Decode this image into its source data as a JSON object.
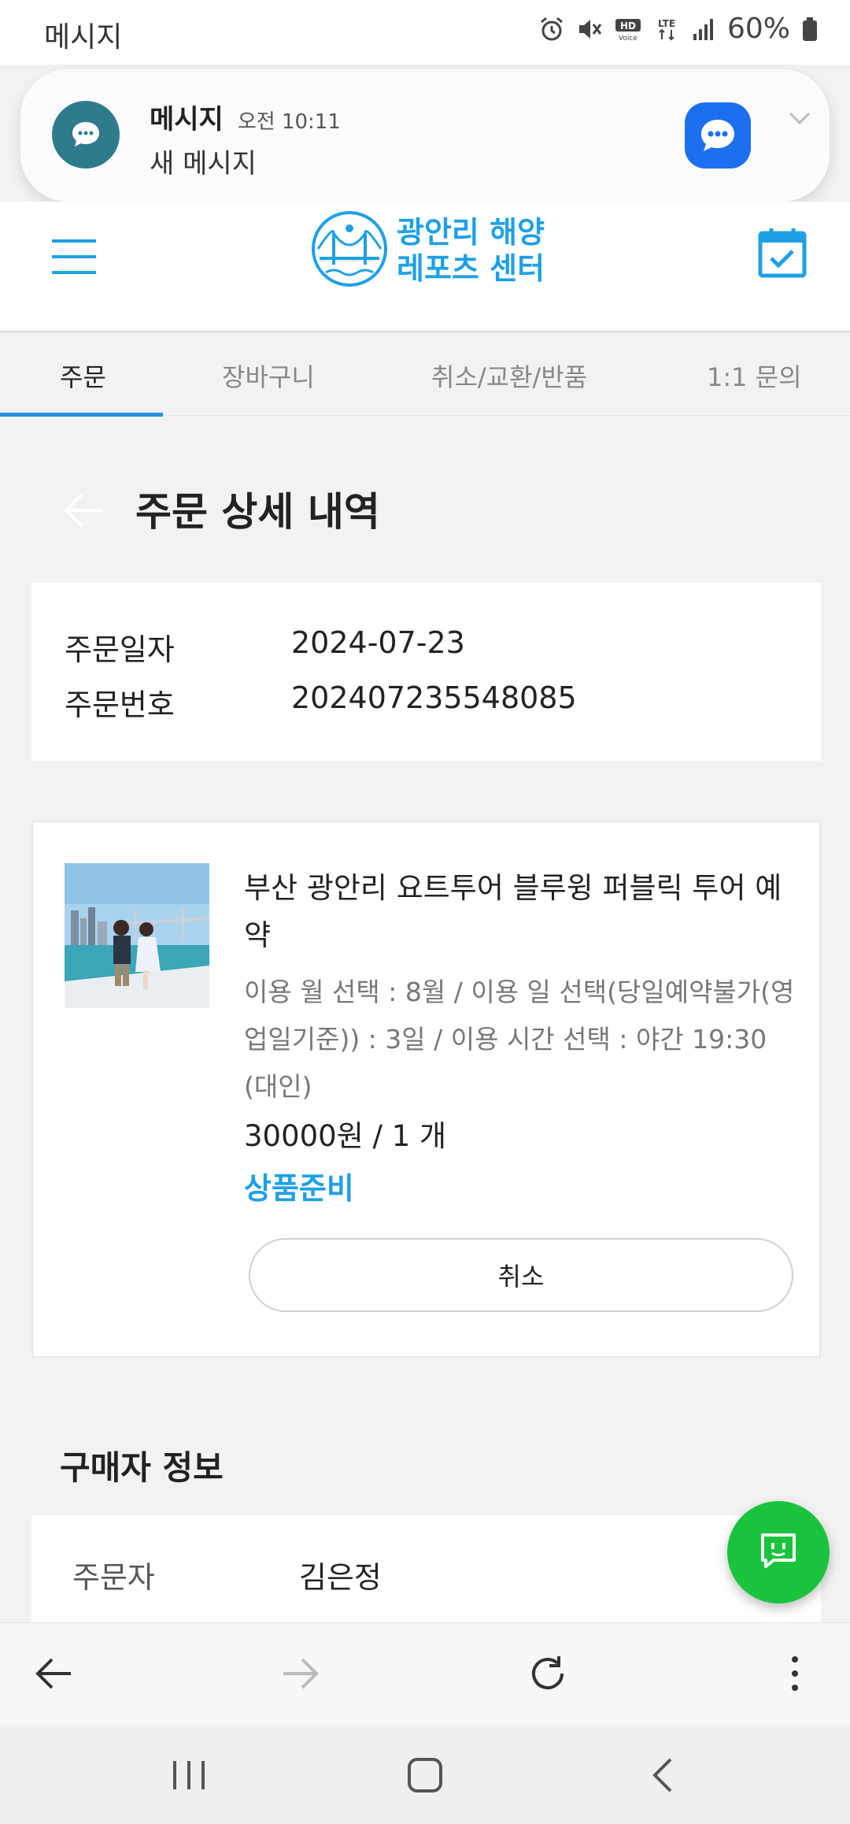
{
  "status_bar": {
    "app_name": "메시지",
    "battery": "60%"
  },
  "notification": {
    "title": "메시지",
    "time": "오전 10:11",
    "body": "새 메시지"
  },
  "header": {
    "logo_line1": "광안리 해양",
    "logo_line2": "레포츠 센터"
  },
  "tabs": [
    {
      "label": "주문"
    },
    {
      "label": "장바구니"
    },
    {
      "label": "취소/교환/반품"
    },
    {
      "label": "1:1 문의"
    }
  ],
  "page": {
    "title": "주문 상세 내역"
  },
  "order_info": {
    "date_label": "주문일자",
    "date_value": "2024-07-23",
    "number_label": "주문번호",
    "number_value": "202407235548085"
  },
  "product": {
    "name": "부산 광안리 요트투어 블루윙 퍼블릭 투어 예약",
    "options": "이용 월 선택 : 8월 / 이용 일 선택(당일예약불가(영업일기준)) : 3일 / 이용 시간 선택 : 야간 19:30 (대인)",
    "price": "30000원 / 1 개",
    "status": "상품준비",
    "cancel_label": "취소"
  },
  "buyer": {
    "section_title": "구매자 정보",
    "orderer_label": "주문자",
    "orderer_value": "김은정"
  },
  "colors": {
    "accent": "#1ea0e6",
    "fab": "#19c43c",
    "notif_icon": "#2e7b8e",
    "messages_app": "#1d6ff2"
  },
  "icons": [
    "alarm-icon",
    "mute-icon",
    "hd-voice-icon",
    "lte-icon",
    "signal-icon",
    "battery-icon",
    "menu-icon",
    "calendar-check-icon",
    "back-arrow-icon",
    "chat-bot-icon",
    "browser-back-icon",
    "browser-forward-icon",
    "refresh-icon",
    "more-icon",
    "recents-icon",
    "home-icon",
    "system-back-icon"
  ]
}
